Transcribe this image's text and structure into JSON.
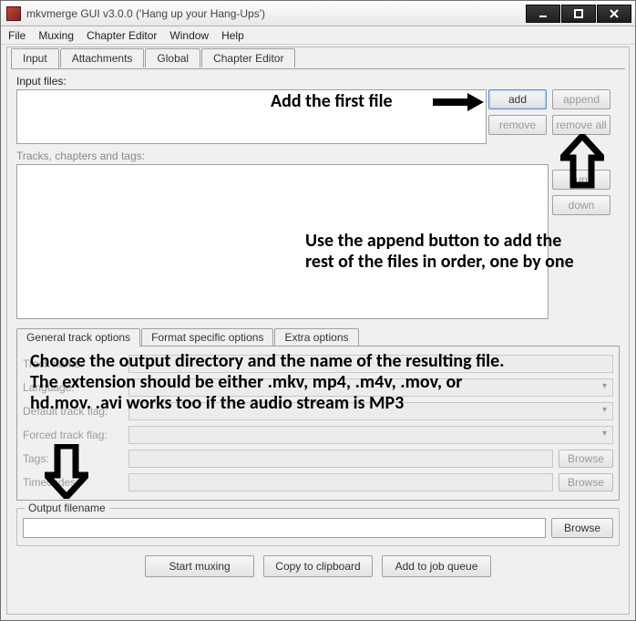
{
  "window": {
    "title": "mkvmerge GUI v3.0.0 ('Hang up your Hang-Ups')"
  },
  "menubar": [
    "File",
    "Muxing",
    "Chapter Editor",
    "Window",
    "Help"
  ],
  "tabs": [
    "Input",
    "Attachments",
    "Global",
    "Chapter Editor"
  ],
  "labels": {
    "input_files": "Input files:",
    "tracks": "Tracks, chapters and tags:",
    "output_group": "Output filename"
  },
  "buttons": {
    "add": "add",
    "append": "append",
    "remove": "remove",
    "remove_all": "remove all",
    "up": "up",
    "down": "down",
    "browse": "Browse",
    "start_muxing": "Start muxing",
    "copy_clipboard": "Copy to clipboard",
    "add_job_queue": "Add to job queue"
  },
  "subtabs": [
    "General track options",
    "Format specific options",
    "Extra options"
  ],
  "trackopts": {
    "row1": "Track name:",
    "row2": "Language:",
    "row3": "Default track flag:",
    "row4": "Forced track flag:",
    "row5": "Tags:",
    "row6": "Timecodes:"
  },
  "annotations": {
    "a1": "Add the first file",
    "a2": "Use the append button to add the rest of the files in order, one by one",
    "a3": "Choose the output directory and the name of the resulting file. The extension should be either .mkv, mp4, .m4v, .mov, or hd.mov. .avi works too if the audio stream is MP3"
  }
}
